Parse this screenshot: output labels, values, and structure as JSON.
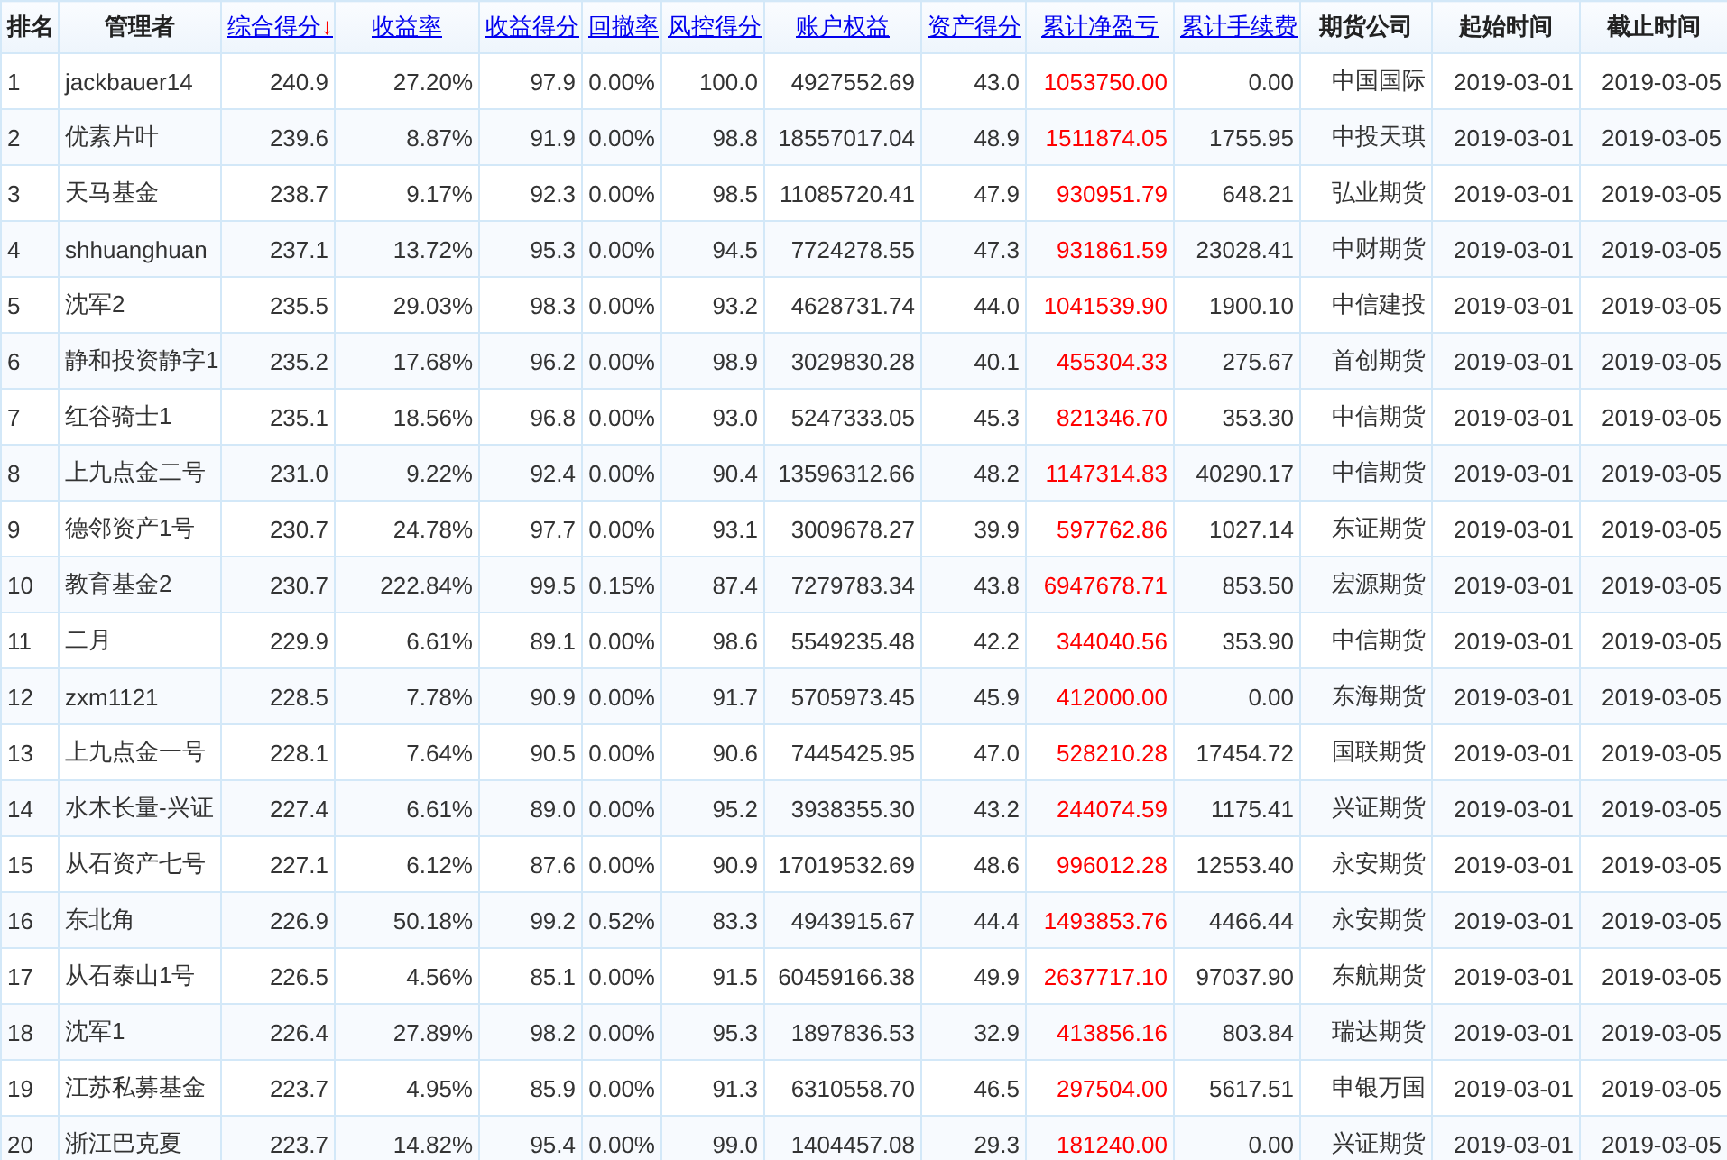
{
  "table": {
    "columns": [
      {
        "label": "排名",
        "kind": "plain"
      },
      {
        "label": "管理者",
        "kind": "plain"
      },
      {
        "label": "综合得分",
        "kind": "link",
        "sort_arrow": "↓"
      },
      {
        "label": "收益率",
        "kind": "link"
      },
      {
        "label": "收益得分",
        "kind": "link"
      },
      {
        "label": "回撤率",
        "kind": "link"
      },
      {
        "label": "风控得分",
        "kind": "link"
      },
      {
        "label": "账户权益",
        "kind": "link"
      },
      {
        "label": "资产得分",
        "kind": "link"
      },
      {
        "label": "累计净盈亏",
        "kind": "link",
        "color": "#ff0000"
      },
      {
        "label": "累计手续费",
        "kind": "link"
      },
      {
        "label": "期货公司",
        "kind": "plain"
      },
      {
        "label": "起始时间",
        "kind": "plain"
      },
      {
        "label": "截止时间",
        "kind": "plain"
      }
    ],
    "rows": [
      [
        "1",
        "jackbauer14",
        "240.9",
        "27.20%",
        "97.9",
        "0.00%",
        "100.0",
        "4927552.69",
        "43.0",
        "1053750.00",
        "0.00",
        "中国国际",
        "2019-03-01",
        "2019-03-05"
      ],
      [
        "2",
        "优素片叶",
        "239.6",
        "8.87%",
        "91.9",
        "0.00%",
        "98.8",
        "18557017.04",
        "48.9",
        "1511874.05",
        "1755.95",
        "中投天琪",
        "2019-03-01",
        "2019-03-05"
      ],
      [
        "3",
        "天马基金",
        "238.7",
        "9.17%",
        "92.3",
        "0.00%",
        "98.5",
        "11085720.41",
        "47.9",
        "930951.79",
        "648.21",
        "弘业期货",
        "2019-03-01",
        "2019-03-05"
      ],
      [
        "4",
        "shhuanghuan",
        "237.1",
        "13.72%",
        "95.3",
        "0.00%",
        "94.5",
        "7724278.55",
        "47.3",
        "931861.59",
        "23028.41",
        "中财期货",
        "2019-03-01",
        "2019-03-05"
      ],
      [
        "5",
        "沈军2",
        "235.5",
        "29.03%",
        "98.3",
        "0.00%",
        "93.2",
        "4628731.74",
        "44.0",
        "1041539.90",
        "1900.10",
        "中信建投",
        "2019-03-01",
        "2019-03-05"
      ],
      [
        "6",
        "静和投资静字1",
        "235.2",
        "17.68%",
        "96.2",
        "0.00%",
        "98.9",
        "3029830.28",
        "40.1",
        "455304.33",
        "275.67",
        "首创期货",
        "2019-03-01",
        "2019-03-05"
      ],
      [
        "7",
        "红谷骑士1",
        "235.1",
        "18.56%",
        "96.8",
        "0.00%",
        "93.0",
        "5247333.05",
        "45.3",
        "821346.70",
        "353.30",
        "中信期货",
        "2019-03-01",
        "2019-03-05"
      ],
      [
        "8",
        "上九点金二号",
        "231.0",
        "9.22%",
        "92.4",
        "0.00%",
        "90.4",
        "13596312.66",
        "48.2",
        "1147314.83",
        "40290.17",
        "中信期货",
        "2019-03-01",
        "2019-03-05"
      ],
      [
        "9",
        "德邻资产1号",
        "230.7",
        "24.78%",
        "97.7",
        "0.00%",
        "93.1",
        "3009678.27",
        "39.9",
        "597762.86",
        "1027.14",
        "东证期货",
        "2019-03-01",
        "2019-03-05"
      ],
      [
        "10",
        "教育基金2",
        "230.7",
        "222.84%",
        "99.5",
        "0.15%",
        "87.4",
        "7279783.34",
        "43.8",
        "6947678.71",
        "853.50",
        "宏源期货",
        "2019-03-01",
        "2019-03-05"
      ],
      [
        "11",
        "二月",
        "229.9",
        "6.61%",
        "89.1",
        "0.00%",
        "98.6",
        "5549235.48",
        "42.2",
        "344040.56",
        "353.90",
        "中信期货",
        "2019-03-01",
        "2019-03-05"
      ],
      [
        "12",
        "zxm1121",
        "228.5",
        "7.78%",
        "90.9",
        "0.00%",
        "91.7",
        "5705973.45",
        "45.9",
        "412000.00",
        "0.00",
        "东海期货",
        "2019-03-01",
        "2019-03-05"
      ],
      [
        "13",
        "上九点金一号",
        "228.1",
        "7.64%",
        "90.5",
        "0.00%",
        "90.6",
        "7445425.95",
        "47.0",
        "528210.28",
        "17454.72",
        "国联期货",
        "2019-03-01",
        "2019-03-05"
      ],
      [
        "14",
        "水木长量-兴证",
        "227.4",
        "6.61%",
        "89.0",
        "0.00%",
        "95.2",
        "3938355.30",
        "43.2",
        "244074.59",
        "1175.41",
        "兴证期货",
        "2019-03-01",
        "2019-03-05"
      ],
      [
        "15",
        "从石资产七号",
        "227.1",
        "6.12%",
        "87.6",
        "0.00%",
        "90.9",
        "17019532.69",
        "48.6",
        "996012.28",
        "12553.40",
        "永安期货",
        "2019-03-01",
        "2019-03-05"
      ],
      [
        "16",
        "东北角",
        "226.9",
        "50.18%",
        "99.2",
        "0.52%",
        "83.3",
        "4943915.67",
        "44.4",
        "1493853.76",
        "4466.44",
        "永安期货",
        "2019-03-01",
        "2019-03-05"
      ],
      [
        "17",
        "从石泰山1号",
        "226.5",
        "4.56%",
        "85.1",
        "0.00%",
        "91.5",
        "60459166.38",
        "49.9",
        "2637717.10",
        "97037.90",
        "东航期货",
        "2019-03-01",
        "2019-03-05"
      ],
      [
        "18",
        "沈军1",
        "226.4",
        "27.89%",
        "98.2",
        "0.00%",
        "95.3",
        "1897836.53",
        "32.9",
        "413856.16",
        "803.84",
        "瑞达期货",
        "2019-03-01",
        "2019-03-05"
      ],
      [
        "19",
        "江苏私募基金",
        "223.7",
        "4.95%",
        "85.9",
        "0.00%",
        "91.3",
        "6310558.70",
        "46.5",
        "297504.00",
        "5617.51",
        "申银万国",
        "2019-03-01",
        "2019-03-05"
      ],
      [
        "20",
        "浙江巴克夏",
        "223.7",
        "14.82%",
        "95.4",
        "0.00%",
        "99.0",
        "1404457.08",
        "29.3",
        "181240.00",
        "0.00",
        "兴证期货",
        "2019-03-01",
        "2019-03-05"
      ]
    ]
  }
}
